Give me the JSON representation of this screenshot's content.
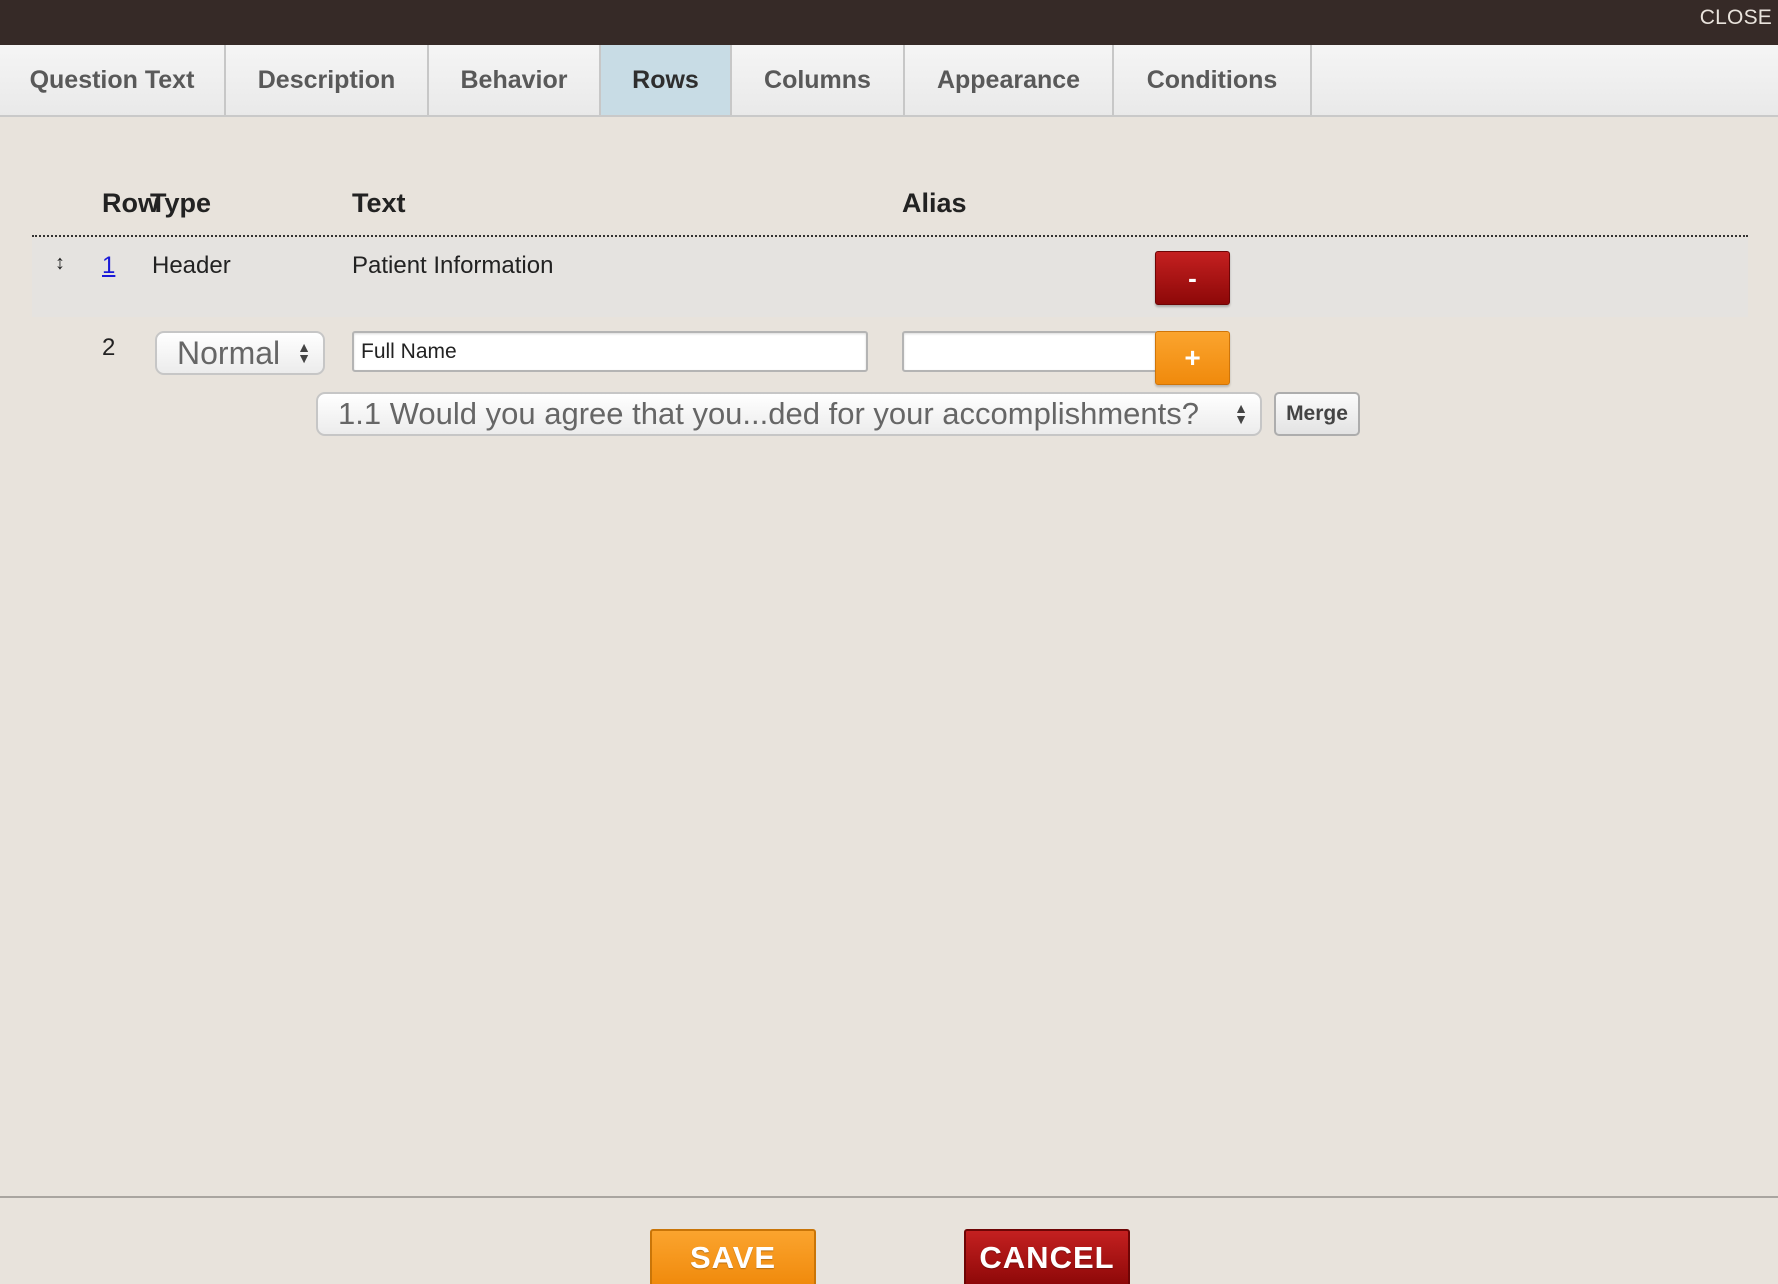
{
  "window": {
    "close_label": "CLOSE"
  },
  "tabs": [
    {
      "label": "Question Text",
      "active": false
    },
    {
      "label": "Description",
      "active": false
    },
    {
      "label": "Behavior",
      "active": false
    },
    {
      "label": "Rows",
      "active": true
    },
    {
      "label": "Columns",
      "active": false
    },
    {
      "label": "Appearance",
      "active": false
    },
    {
      "label": "Conditions",
      "active": false
    }
  ],
  "grid": {
    "headers": {
      "row": "Row",
      "type": "Type",
      "text": "Text",
      "alias": "Alias"
    },
    "rows": [
      {
        "number": "1",
        "type": "Header",
        "text": "Patient Information",
        "remove_label": "-"
      },
      {
        "number": "2",
        "type_selected": "Normal",
        "text_value": "Full Name",
        "alias_value": "",
        "add_label": "+",
        "merge_select_value": "1.1 Would you agree that you...ded for your accomplishments?",
        "merge_label": "Merge"
      }
    ]
  },
  "footer": {
    "save_label": "SAVE",
    "cancel_label": "CANCEL"
  },
  "colors": {
    "topbar": "#362a27",
    "active_tab": "#c8dce5",
    "orange_button": "#f39317",
    "red_button": "#ab1414",
    "background": "#e8e3dc"
  }
}
